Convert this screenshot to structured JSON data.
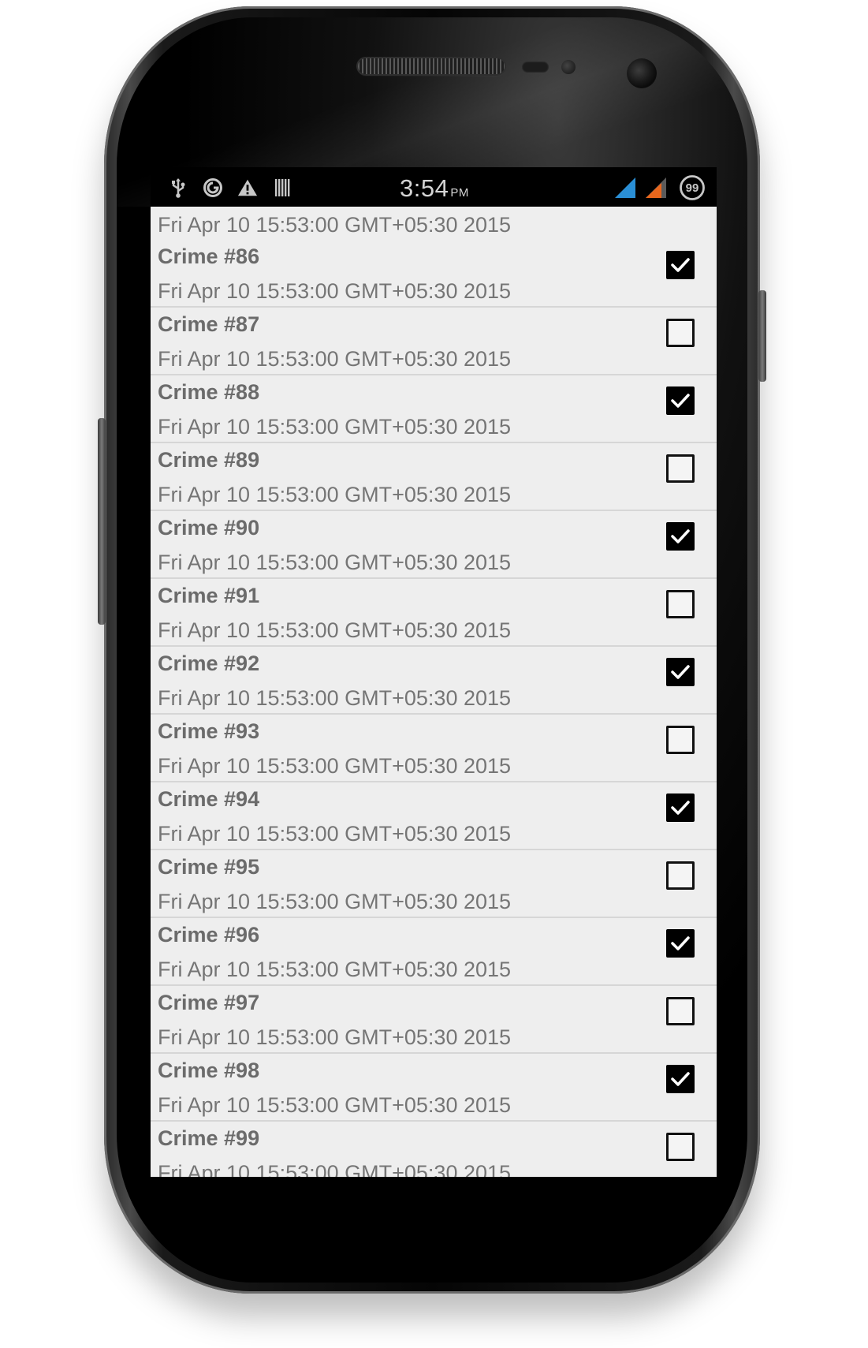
{
  "status_bar": {
    "time": "3:54",
    "ampm": "PM",
    "left_icons": [
      "usb-icon",
      "sync-icon",
      "warning-icon",
      "barcode-icon"
    ],
    "right_icons": [
      "signal-blue-icon",
      "signal-orange-icon",
      "battery-icon"
    ],
    "battery_level": "99",
    "colors": {
      "signal_blue": "#2a8fd6",
      "signal_orange": "#e8661c"
    }
  },
  "crime_list": {
    "partial_top_date": "Fri Apr 10 15:53:00 GMT+05:30 2015",
    "items": [
      {
        "title": "Crime #86",
        "date": "Fri Apr 10 15:53:00 GMT+05:30 2015",
        "solved": true
      },
      {
        "title": "Crime #87",
        "date": "Fri Apr 10 15:53:00 GMT+05:30 2015",
        "solved": false
      },
      {
        "title": "Crime #88",
        "date": "Fri Apr 10 15:53:00 GMT+05:30 2015",
        "solved": true
      },
      {
        "title": "Crime #89",
        "date": "Fri Apr 10 15:53:00 GMT+05:30 2015",
        "solved": false
      },
      {
        "title": "Crime #90",
        "date": "Fri Apr 10 15:53:00 GMT+05:30 2015",
        "solved": true
      },
      {
        "title": "Crime #91",
        "date": "Fri Apr 10 15:53:00 GMT+05:30 2015",
        "solved": false
      },
      {
        "title": "Crime #92",
        "date": "Fri Apr 10 15:53:00 GMT+05:30 2015",
        "solved": true
      },
      {
        "title": "Crime #93",
        "date": "Fri Apr 10 15:53:00 GMT+05:30 2015",
        "solved": false
      },
      {
        "title": "Crime #94",
        "date": "Fri Apr 10 15:53:00 GMT+05:30 2015",
        "solved": true
      },
      {
        "title": "Crime #95",
        "date": "Fri Apr 10 15:53:00 GMT+05:30 2015",
        "solved": false
      },
      {
        "title": "Crime #96",
        "date": "Fri Apr 10 15:53:00 GMT+05:30 2015",
        "solved": true
      },
      {
        "title": "Crime #97",
        "date": "Fri Apr 10 15:53:00 GMT+05:30 2015",
        "solved": false
      },
      {
        "title": "Crime #98",
        "date": "Fri Apr 10 15:53:00 GMT+05:30 2015",
        "solved": true
      },
      {
        "title": "Crime #99",
        "date": "Fri Apr 10 15:53:00 GMT+05:30 2015",
        "solved": false
      }
    ]
  }
}
